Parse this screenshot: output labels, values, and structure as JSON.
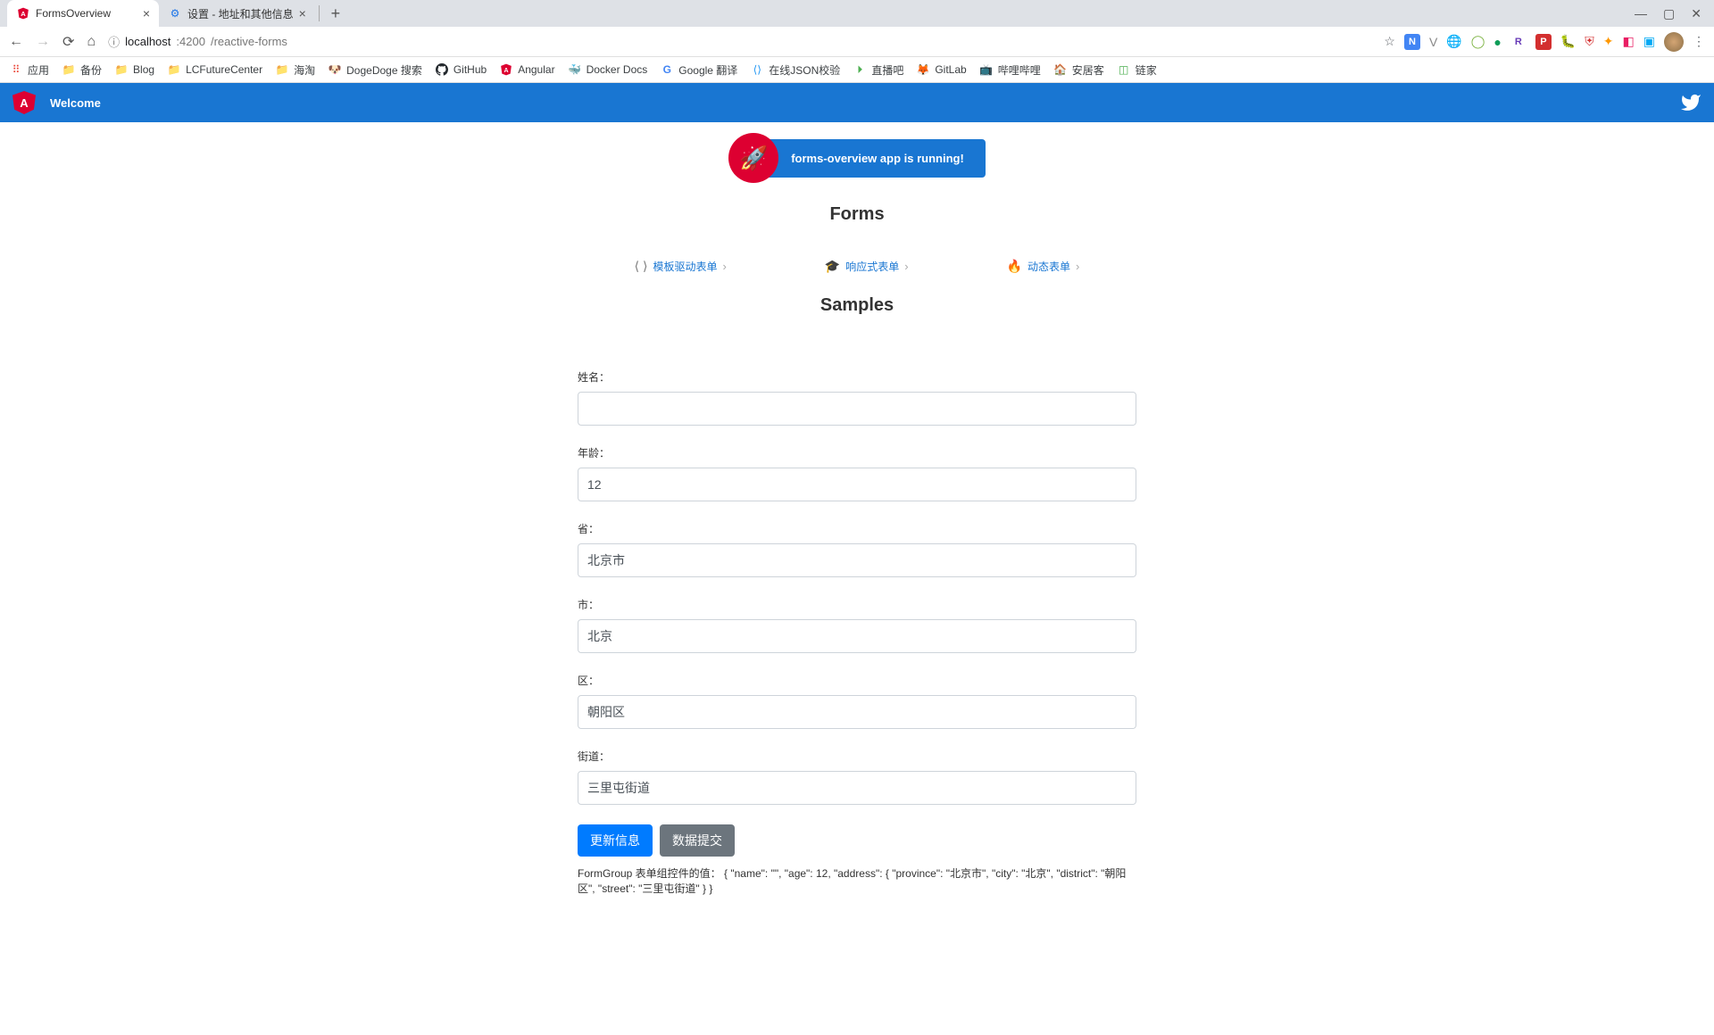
{
  "browser": {
    "tabs": [
      {
        "title": "FormsOverview",
        "favicon": "angular"
      },
      {
        "title": "设置 - 地址和其他信息",
        "favicon": "gear"
      }
    ],
    "url_host": "localhost",
    "url_port": ":4200",
    "url_path": "/reactive-forms",
    "bookmarks": [
      {
        "label": "应用",
        "icon": "apps"
      },
      {
        "label": "备份",
        "icon": "folder"
      },
      {
        "label": "Blog",
        "icon": "folder"
      },
      {
        "label": "LCFutureCenter",
        "icon": "folder"
      },
      {
        "label": "海淘",
        "icon": "folder"
      },
      {
        "label": "DogeDoge 搜索",
        "icon": "doge"
      },
      {
        "label": "GitHub",
        "icon": "github"
      },
      {
        "label": "Angular",
        "icon": "angular"
      },
      {
        "label": "Docker Docs",
        "icon": "docker"
      },
      {
        "label": "Google 翻译",
        "icon": "google"
      },
      {
        "label": "在线JSON校验",
        "icon": "json"
      },
      {
        "label": "直播吧",
        "icon": "zhibo"
      },
      {
        "label": "GitLab",
        "icon": "gitlab"
      },
      {
        "label": "哔哩哔哩",
        "icon": "bili"
      },
      {
        "label": "安居客",
        "icon": "anjuke"
      },
      {
        "label": "链家",
        "icon": "lianjia"
      }
    ]
  },
  "app": {
    "header_title": "Welcome",
    "banner_text": "forms-overview app is running!",
    "forms_title": "Forms",
    "samples_title": "Samples",
    "nav_cards": [
      {
        "label": "模板驱动表单",
        "icon": "code"
      },
      {
        "label": "响应式表单",
        "icon": "grad"
      },
      {
        "label": "动态表单",
        "icon": "fire"
      }
    ],
    "form": {
      "name_label": "姓名：",
      "name_value": "",
      "age_label": "年龄：",
      "age_value": "12",
      "province_label": "省：",
      "province_value": "北京市",
      "city_label": "市：",
      "city_value": "北京",
      "district_label": "区：",
      "district_value": "朝阳区",
      "street_label": "街道：",
      "street_value": "三里屯街道",
      "update_btn": "更新信息",
      "submit_btn": "数据提交",
      "value_label": "FormGroup 表单组控件的值：",
      "value_json": "{ \"name\": \"\", \"age\": 12, \"address\": { \"province\": \"北京市\", \"city\": \"北京\", \"district\": \"朝阳区\", \"street\": \"三里屯街道\" } }"
    }
  }
}
